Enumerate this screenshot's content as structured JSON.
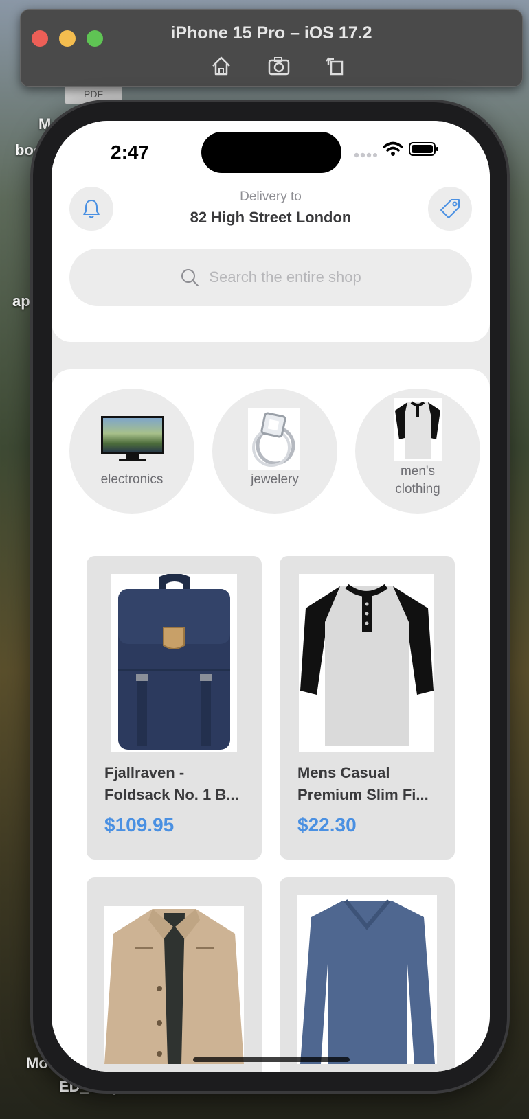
{
  "desktop": {
    "labels": [
      "M",
      "boc",
      "ap",
      "Mol",
      "ED_CV.pdf"
    ],
    "pdf_tab": "PDF"
  },
  "simulator": {
    "title": "iPhone 15 Pro – iOS 17.2",
    "toolbar": [
      "home-icon",
      "screenshot-icon",
      "rotate-icon"
    ]
  },
  "status_bar": {
    "time": "2:47"
  },
  "header": {
    "delivery_label": "Delivery to",
    "delivery_address": "82 High Street London"
  },
  "search": {
    "placeholder": "Search the entire shop"
  },
  "categories": [
    {
      "label": "electronics"
    },
    {
      "label": "jewelery"
    },
    {
      "label": "men's clothing"
    }
  ],
  "products": [
    {
      "title": "Fjallraven - Foldsack No. 1 B...",
      "price": "$109.95"
    },
    {
      "title": "Mens Casual Premium Slim Fi...",
      "price": "$22.30"
    },
    {
      "title": "",
      "price": ""
    },
    {
      "title": "",
      "price": ""
    }
  ],
  "colors": {
    "accent": "#4a90e2"
  }
}
